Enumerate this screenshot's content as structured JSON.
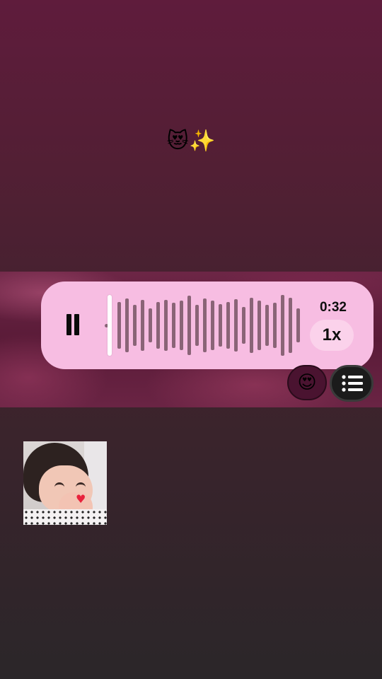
{
  "story": {
    "caption": "😻✨"
  },
  "voice_message": {
    "duration": "0:32",
    "playback_speed": "1x",
    "state": "playing",
    "progress": 0.0,
    "play_pause_icon": "pause-icon"
  },
  "actions": {
    "reaction_emoji": "😍",
    "list_icon": "list-icon"
  },
  "sticker": {
    "icon": "baby-blowing-kiss-sticker"
  },
  "colors": {
    "background_top": "#5f1c3c",
    "background_bottom": "#2b2629",
    "card": "#f7bde2",
    "waveform": "#8a6477",
    "speed_pill": "#fbd2eb"
  }
}
